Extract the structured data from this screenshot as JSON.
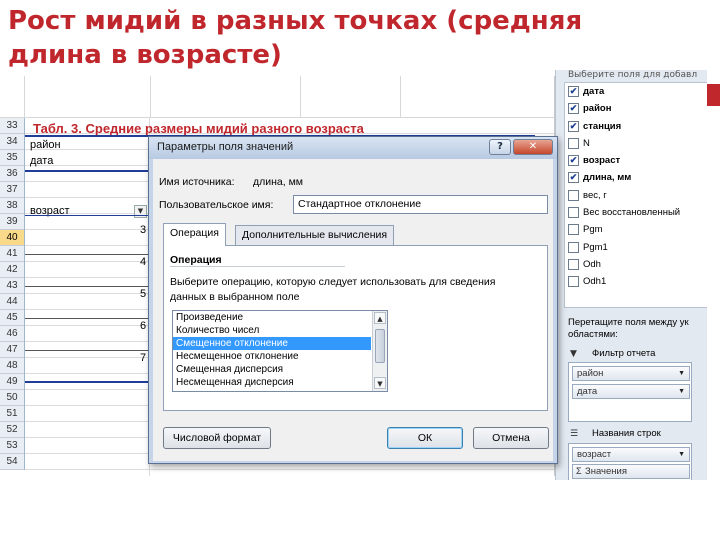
{
  "slide": {
    "title": "Рост мидий в разных точках (средняя длина в возрасте)"
  },
  "sheet": {
    "table_title": "Табл. 3. Средние размеры мидий разного возраста",
    "row_numbers": [
      "33",
      "34",
      "35",
      "36",
      "37",
      "38",
      "39",
      "40",
      "41",
      "42",
      "43",
      "44",
      "45",
      "46",
      "47",
      "48",
      "49",
      "50",
      "51",
      "52",
      "53",
      "54"
    ],
    "active_row": "40",
    "filter_rows": [
      {
        "label": "район"
      },
      {
        "label": "дата"
      }
    ],
    "row_field_label": "возраст",
    "age_values": [
      "3",
      "4",
      "5",
      "6",
      "7"
    ]
  },
  "field_panel": {
    "header_cut": "Выберите поля для добавл",
    "fields": [
      {
        "label": "дата",
        "checked": true,
        "bold": true
      },
      {
        "label": "район",
        "checked": true,
        "bold": true
      },
      {
        "label": "станция",
        "checked": true,
        "bold": true
      },
      {
        "label": "N",
        "checked": false,
        "bold": false
      },
      {
        "label": "возраст",
        "checked": true,
        "bold": true
      },
      {
        "label": "длина, мм",
        "checked": true,
        "bold": true
      },
      {
        "label": "вес, г",
        "checked": false,
        "bold": false
      },
      {
        "label": "Вес восстановленный",
        "checked": false,
        "bold": false
      },
      {
        "label": "Pgm",
        "checked": false,
        "bold": false
      },
      {
        "label": "Pgm1",
        "checked": false,
        "bold": false
      },
      {
        "label": "Odh",
        "checked": false,
        "bold": false
      },
      {
        "label": "Odh1",
        "checked": false,
        "bold": false
      }
    ],
    "drag_hint_1": "Перетащите поля между ук",
    "drag_hint_2": "областями:",
    "report_filter_label": "Фильтр отчета",
    "report_filter_chips": [
      "район",
      "дата"
    ],
    "row_labels_label": "Названия строк",
    "row_label_chips": [
      "возраст",
      "Значения"
    ]
  },
  "dialog": {
    "title": "Параметры поля значений",
    "help_button": "?",
    "close_button": "✕",
    "source_name_label": "Имя источника:",
    "source_name_value": "длина, мм",
    "custom_name_label": "Пользовательское имя:",
    "custom_name_value": "Стандартное отклонение",
    "tabs": [
      {
        "label": "Операция",
        "active": true
      },
      {
        "label": "Дополнительные вычисления",
        "active": false
      }
    ],
    "section_title": "Операция",
    "description": "Выберите операцию, которую следует использовать для сведения данных в выбранном поле",
    "operations": [
      {
        "label": "Произведение",
        "selected": false
      },
      {
        "label": "Количество чисел",
        "selected": false
      },
      {
        "label": "Смещенное отклонение",
        "selected": true
      },
      {
        "label": "Несмещенное отклонение",
        "selected": false
      },
      {
        "label": "Смещенная дисперсия",
        "selected": false
      },
      {
        "label": "Несмещенная дисперсия",
        "selected": false
      }
    ],
    "number_format_button": "Числовой формат",
    "ok_button": "ОК",
    "cancel_button": "Отмена"
  },
  "colors": {
    "title_red": "#c0272d",
    "selection_blue": "#3399ff",
    "rule_blue": "#1f3d99"
  }
}
